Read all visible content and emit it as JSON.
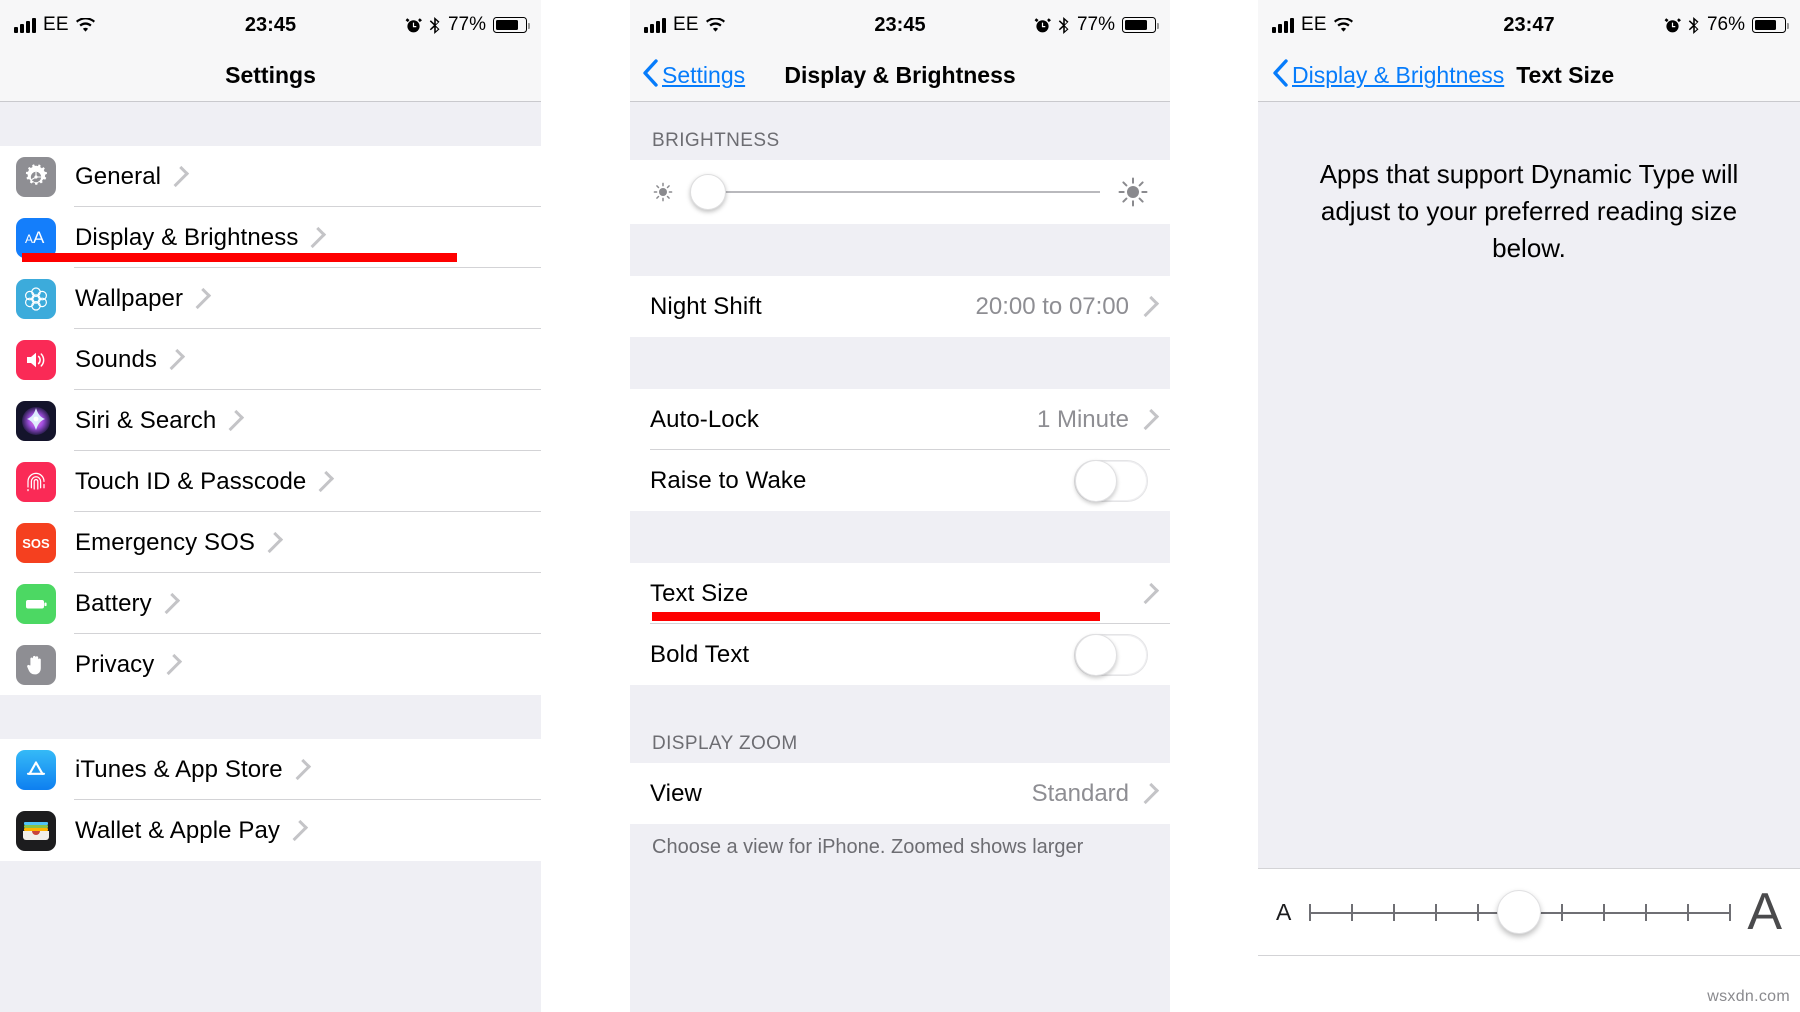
{
  "panels": {
    "settings": {
      "status": {
        "carrier": "EE",
        "time": "23:45",
        "battery_pct": "77%"
      },
      "nav": {
        "title": "Settings"
      },
      "groups": [
        {
          "rows": [
            {
              "label": "General",
              "icon": "gear-icon",
              "icon_color": "#8e8e93"
            },
            {
              "label": "Display & Brightness",
              "icon": "aa-icon",
              "icon_color": "#147efb"
            },
            {
              "label": "Wallpaper",
              "icon": "wallpaper-icon",
              "icon_color": "#3cabdb"
            },
            {
              "label": "Sounds",
              "icon": "speaker-icon",
              "icon_color": "#fa2a56"
            },
            {
              "label": "Siri & Search",
              "icon": "siri-icon",
              "icon_color": "#1b1b33"
            },
            {
              "label": "Touch ID & Passcode",
              "icon": "fingerprint-icon",
              "icon_color": "#fa2a56"
            },
            {
              "label": "Emergency SOS",
              "icon": "sos-icon",
              "icon_color": "#f5401f"
            },
            {
              "label": "Battery",
              "icon": "battery-icon",
              "icon_color": "#4cd863"
            },
            {
              "label": "Privacy",
              "icon": "hand-icon",
              "icon_color": "#8e8e93"
            }
          ]
        },
        {
          "rows": [
            {
              "label": "iTunes & App Store",
              "icon": "appstore-icon",
              "icon_color": "#2ca8f2"
            },
            {
              "label": "Wallet & Apple Pay",
              "icon": "wallet-icon",
              "icon_color": "#1c1c1e"
            }
          ]
        }
      ],
      "highlight": {
        "target": "Display & Brightness",
        "color": "#fe0000"
      }
    },
    "display": {
      "status": {
        "carrier": "EE",
        "time": "23:45",
        "battery_pct": "77%"
      },
      "nav": {
        "back_label": "Settings",
        "title": "Display & Brightness"
      },
      "section_brightness_header": "BRIGHTNESS",
      "brightness_slider": {
        "value_pct": 4,
        "left_icon": "sun-small-icon",
        "right_icon": "sun-large-icon"
      },
      "rows": [
        {
          "label": "Night Shift",
          "value": "20:00 to 07:00",
          "type": "disclosure"
        },
        {
          "label": "Auto-Lock",
          "value": "1 Minute",
          "type": "disclosure"
        },
        {
          "label": "Raise to Wake",
          "type": "toggle",
          "toggle_on": false
        },
        {
          "label": "Text Size",
          "type": "disclosure"
        },
        {
          "label": "Bold Text",
          "type": "toggle",
          "toggle_on": false
        },
        {
          "label": "View",
          "value": "Standard",
          "type": "disclosure"
        }
      ],
      "section_zoom_header": "DISPLAY ZOOM",
      "footnote": "Choose a view for iPhone. Zoomed shows larger",
      "highlight": {
        "target": "Text Size",
        "color": "#fe0000"
      }
    },
    "textsize": {
      "status": {
        "carrier": "EE",
        "time": "23:47",
        "battery_pct": "76%"
      },
      "nav": {
        "back_label": "Display & Brightness",
        "title": "Text Size"
      },
      "blurb": "Apps that support Dynamic Type will adjust to your preferred reading size below.",
      "slider": {
        "min_label": "A",
        "max_label": "A",
        "tick_count": 11,
        "value_index": 5,
        "value_pct": 50
      }
    }
  },
  "watermark": "wsxdn.com"
}
